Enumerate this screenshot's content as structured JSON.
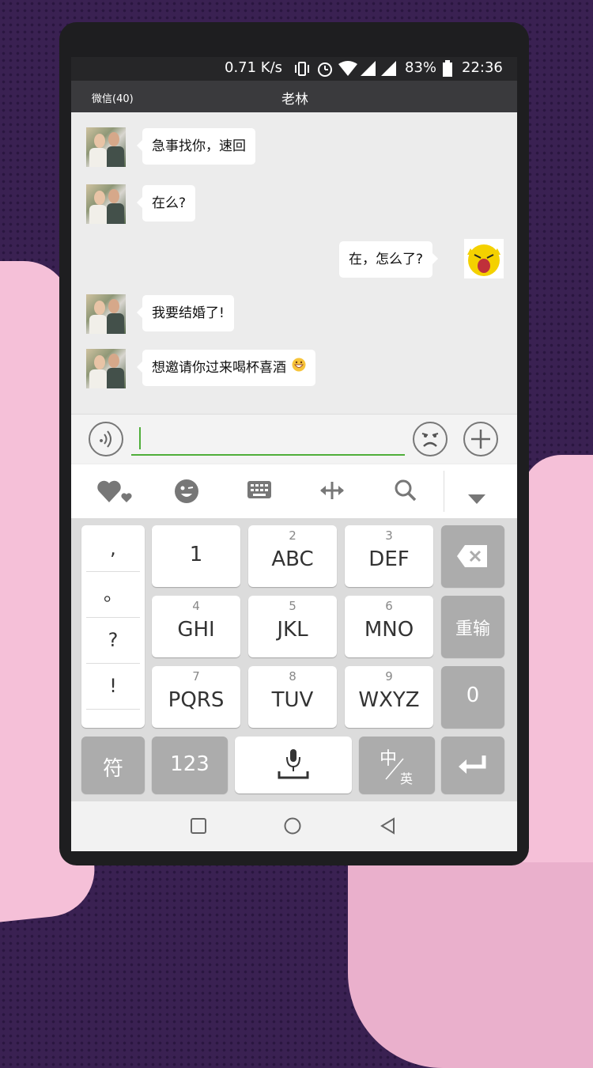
{
  "status_bar": {
    "net_speed": "0.71 K/s",
    "battery": "83%",
    "time": "22:36"
  },
  "title_bar": {
    "back_label": "微信(40)",
    "chat_title": "老林"
  },
  "messages": [
    {
      "side": "left",
      "text": "急事找你，速回"
    },
    {
      "side": "left",
      "text": "在么?"
    },
    {
      "side": "right",
      "text": "在，怎么了?"
    },
    {
      "side": "left",
      "text": "我要结婚了!"
    },
    {
      "side": "left",
      "text": "想邀请你过来喝杯喜酒"
    }
  ],
  "keyboard": {
    "punct": [
      ",",
      "。",
      "?",
      "!"
    ],
    "rows": [
      [
        {
          "num": "",
          "label": "1"
        },
        {
          "num": "2",
          "label": "ABC"
        },
        {
          "num": "3",
          "label": "DEF"
        }
      ],
      [
        {
          "num": "4",
          "label": "GHI"
        },
        {
          "num": "5",
          "label": "JKL"
        },
        {
          "num": "6",
          "label": "MNO"
        }
      ],
      [
        {
          "num": "7",
          "label": "PQRS"
        },
        {
          "num": "8",
          "label": "TUV"
        },
        {
          "num": "9",
          "label": "WXYZ"
        }
      ]
    ],
    "reinput": "重输",
    "zero": "0",
    "symbol": "符",
    "numeric": "123",
    "lang_main": "中",
    "lang_sub": "英"
  },
  "colors": {
    "accent_green": "#4fae3a",
    "background_purple": "#3a2152",
    "hand_pink": "#f5c0d8"
  }
}
